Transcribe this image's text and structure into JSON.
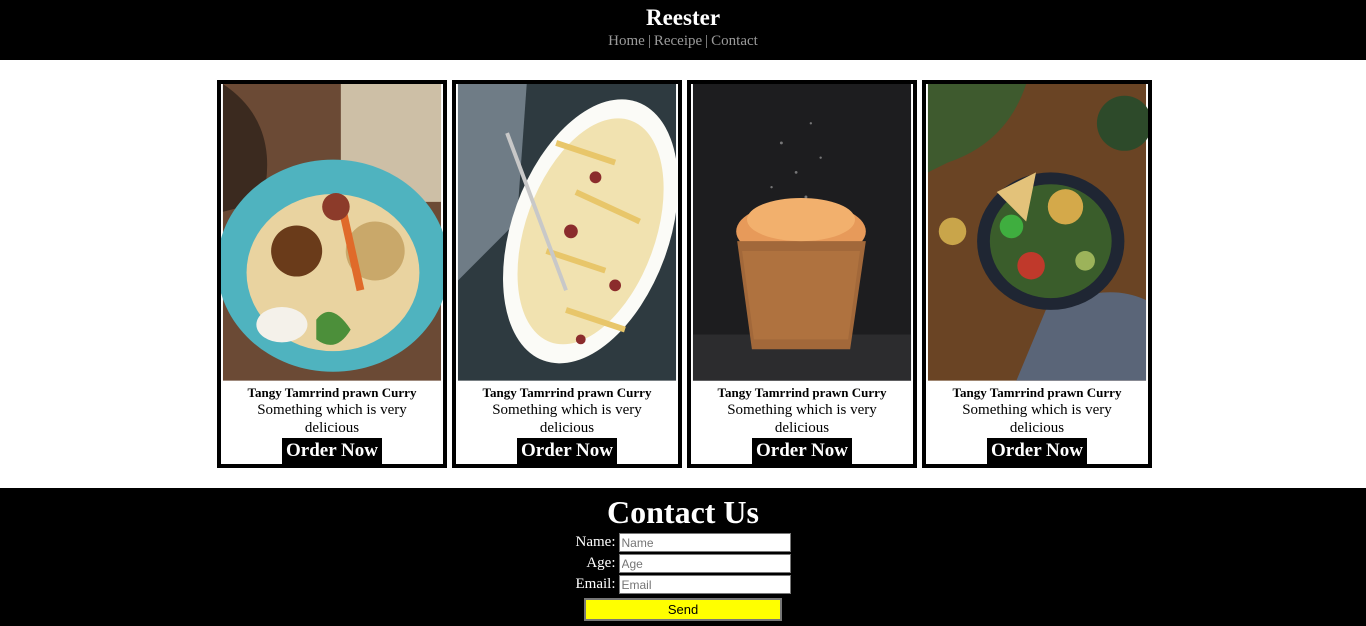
{
  "header": {
    "brand": "Reester",
    "nav": [
      "Home",
      "Receipe",
      "Contact"
    ],
    "separator": "|"
  },
  "cards": [
    {
      "title": "Tangy Tamrrind prawn Curry",
      "description": "Something which is very delicious",
      "button": "Order Now",
      "image": "food-bowl-photo"
    },
    {
      "title": "Tangy Tamrrind prawn Curry",
      "description": "Something which is very delicious",
      "button": "Order Now",
      "image": "fries-plate-photo"
    },
    {
      "title": "Tangy Tamrrind prawn Curry",
      "description": "Something which is very delicious",
      "button": "Order Now",
      "image": "muffin-photo"
    },
    {
      "title": "Tangy Tamrrind prawn Curry",
      "description": "Something which is very delicious",
      "button": "Order Now",
      "image": "salad-bowl-photo"
    }
  ],
  "contact": {
    "title": "Contact Us",
    "fields": [
      {
        "label": "Name:",
        "placeholder": "Name"
      },
      {
        "label": "Age:",
        "placeholder": "Age"
      },
      {
        "label": "Email:",
        "placeholder": "Email"
      }
    ],
    "send_label": "Send"
  },
  "colors": {
    "header_bg": "#000000",
    "nav_text": "#9a9a9a",
    "send_button": "#ffff00"
  }
}
